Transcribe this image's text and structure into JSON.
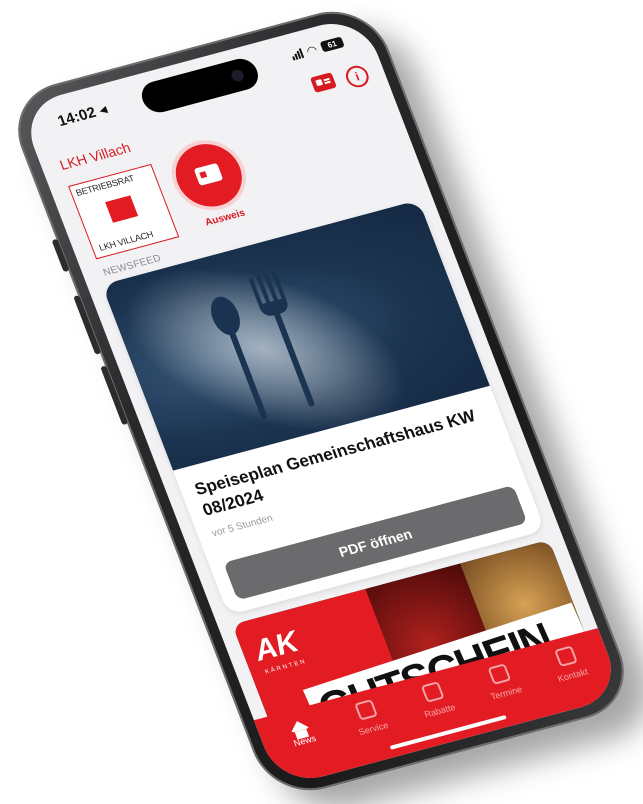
{
  "status": {
    "time": "14:02 ◂",
    "battery": "61"
  },
  "header": {
    "title": "LKH Villach"
  },
  "logo": {
    "top_text": "BETRIEBSRAT",
    "bottom_text": "LKH VILLACH"
  },
  "ausweis": {
    "label": "Ausweis"
  },
  "newsfeed": {
    "label": "NEWSFEED",
    "card": {
      "title": "Speiseplan Gemeinschaftshaus KW 08/2024",
      "time": "vor 5 Stunden",
      "button": "PDF öffnen"
    }
  },
  "promo": {
    "brand": "AK",
    "brand_sub": "KÄRNTEN",
    "text": "GUTSCHEIN"
  },
  "tabs": [
    {
      "label": "News",
      "active": true
    },
    {
      "label": "Service",
      "active": false
    },
    {
      "label": "Rabatte",
      "active": false
    },
    {
      "label": "Termine",
      "active": false
    },
    {
      "label": "Kontakt",
      "active": false
    }
  ],
  "colors": {
    "brand_red": "#e31b23",
    "button_grey": "#6b6b6e"
  }
}
